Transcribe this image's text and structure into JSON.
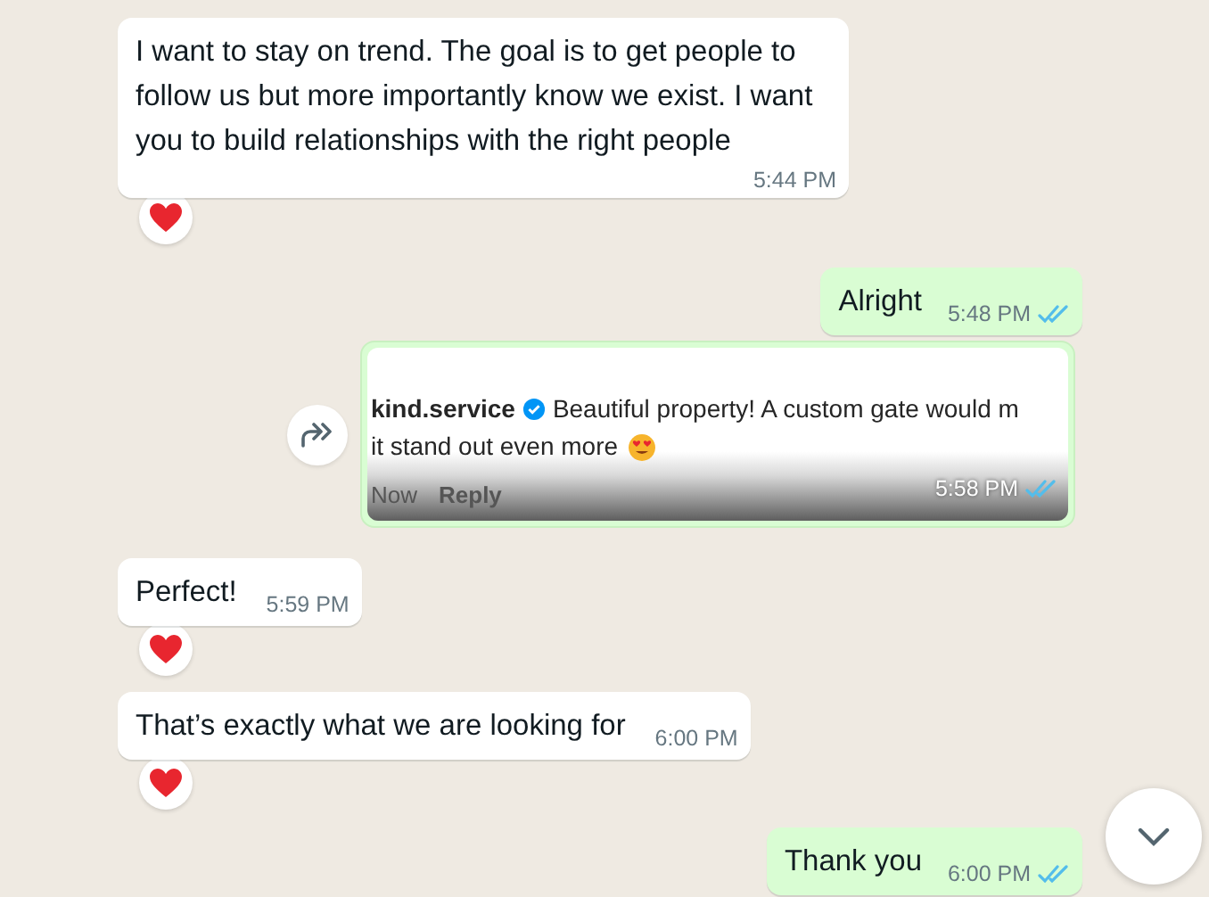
{
  "messages": [
    {
      "kind": "text",
      "outgoing": false,
      "text": "I want to stay on trend. The goal is to get people to follow us but more importantly know we exist. I want you to build relationships with the right people",
      "time": "5:44 PM",
      "reacted": true
    },
    {
      "kind": "text",
      "outgoing": true,
      "text": "Alright",
      "time": "5:48 PM",
      "read": true,
      "reacted": false
    },
    {
      "kind": "image",
      "outgoing": true,
      "forward": true,
      "shot": {
        "user": "kind.service",
        "verified": true,
        "text": "Beautiful property! A custom gate would m",
        "text2": "it stand out even more",
        "emoji": true,
        "age": "Now",
        "reply": "Reply"
      },
      "time": "5:58 PM",
      "read": true,
      "reacted": false
    },
    {
      "kind": "text",
      "outgoing": false,
      "text": "Perfect!",
      "time": "5:59 PM",
      "reacted": true
    },
    {
      "kind": "text",
      "outgoing": false,
      "text": "That’s exactly what we are looking for",
      "time": "6:00 PM",
      "reacted": true
    },
    {
      "kind": "text",
      "outgoing": true,
      "text": "Thank you",
      "time": "6:00 PM",
      "read": true,
      "reacted": false
    }
  ]
}
